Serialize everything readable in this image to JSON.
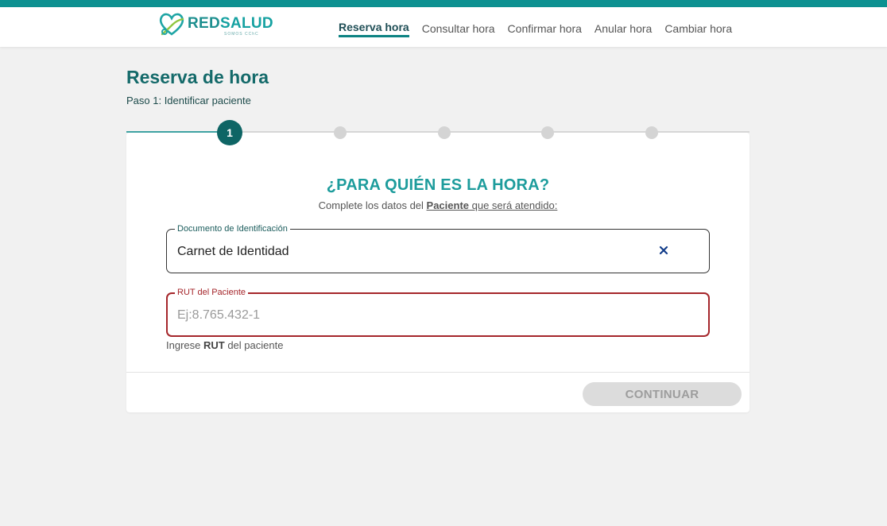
{
  "header": {
    "logo": {
      "brand_red": "RED",
      "brand_salud": "SALUD",
      "tagline": "SOMOS CChC"
    },
    "nav": [
      {
        "label": "Reserva hora",
        "active": true
      },
      {
        "label": "Consultar hora",
        "active": false
      },
      {
        "label": "Confirmar hora",
        "active": false
      },
      {
        "label": "Anular hora",
        "active": false
      },
      {
        "label": "Cambiar hora",
        "active": false
      }
    ]
  },
  "page": {
    "title": "Reserva de hora",
    "subtitle": "Paso 1: Identificar paciente"
  },
  "stepper": {
    "current_step": "1",
    "total_steps": 5
  },
  "form": {
    "question": "¿PARA QUIÉN ES LA HORA?",
    "instruction_prefix": "Complete los datos del ",
    "instruction_bold": "Paciente",
    "instruction_suffix": " que será atendido:",
    "document_field": {
      "legend": "Documento de Identificación",
      "value": "Carnet de Identidad",
      "clear_icon": "close-icon"
    },
    "rut_field": {
      "legend": "RUT del Paciente",
      "placeholder": "Ej:8.765.432-1",
      "value": ""
    },
    "helper_prefix": "Ingrese ",
    "helper_bold": "RUT",
    "helper_suffix": " del paciente",
    "continue_label": "CONTINUAR"
  },
  "colors": {
    "top_bar": "#0d9191",
    "accent": "#1d9c9c",
    "step_active": "#0e6565",
    "error": "#a5262b",
    "button_disabled_bg": "#dcdcdc"
  }
}
